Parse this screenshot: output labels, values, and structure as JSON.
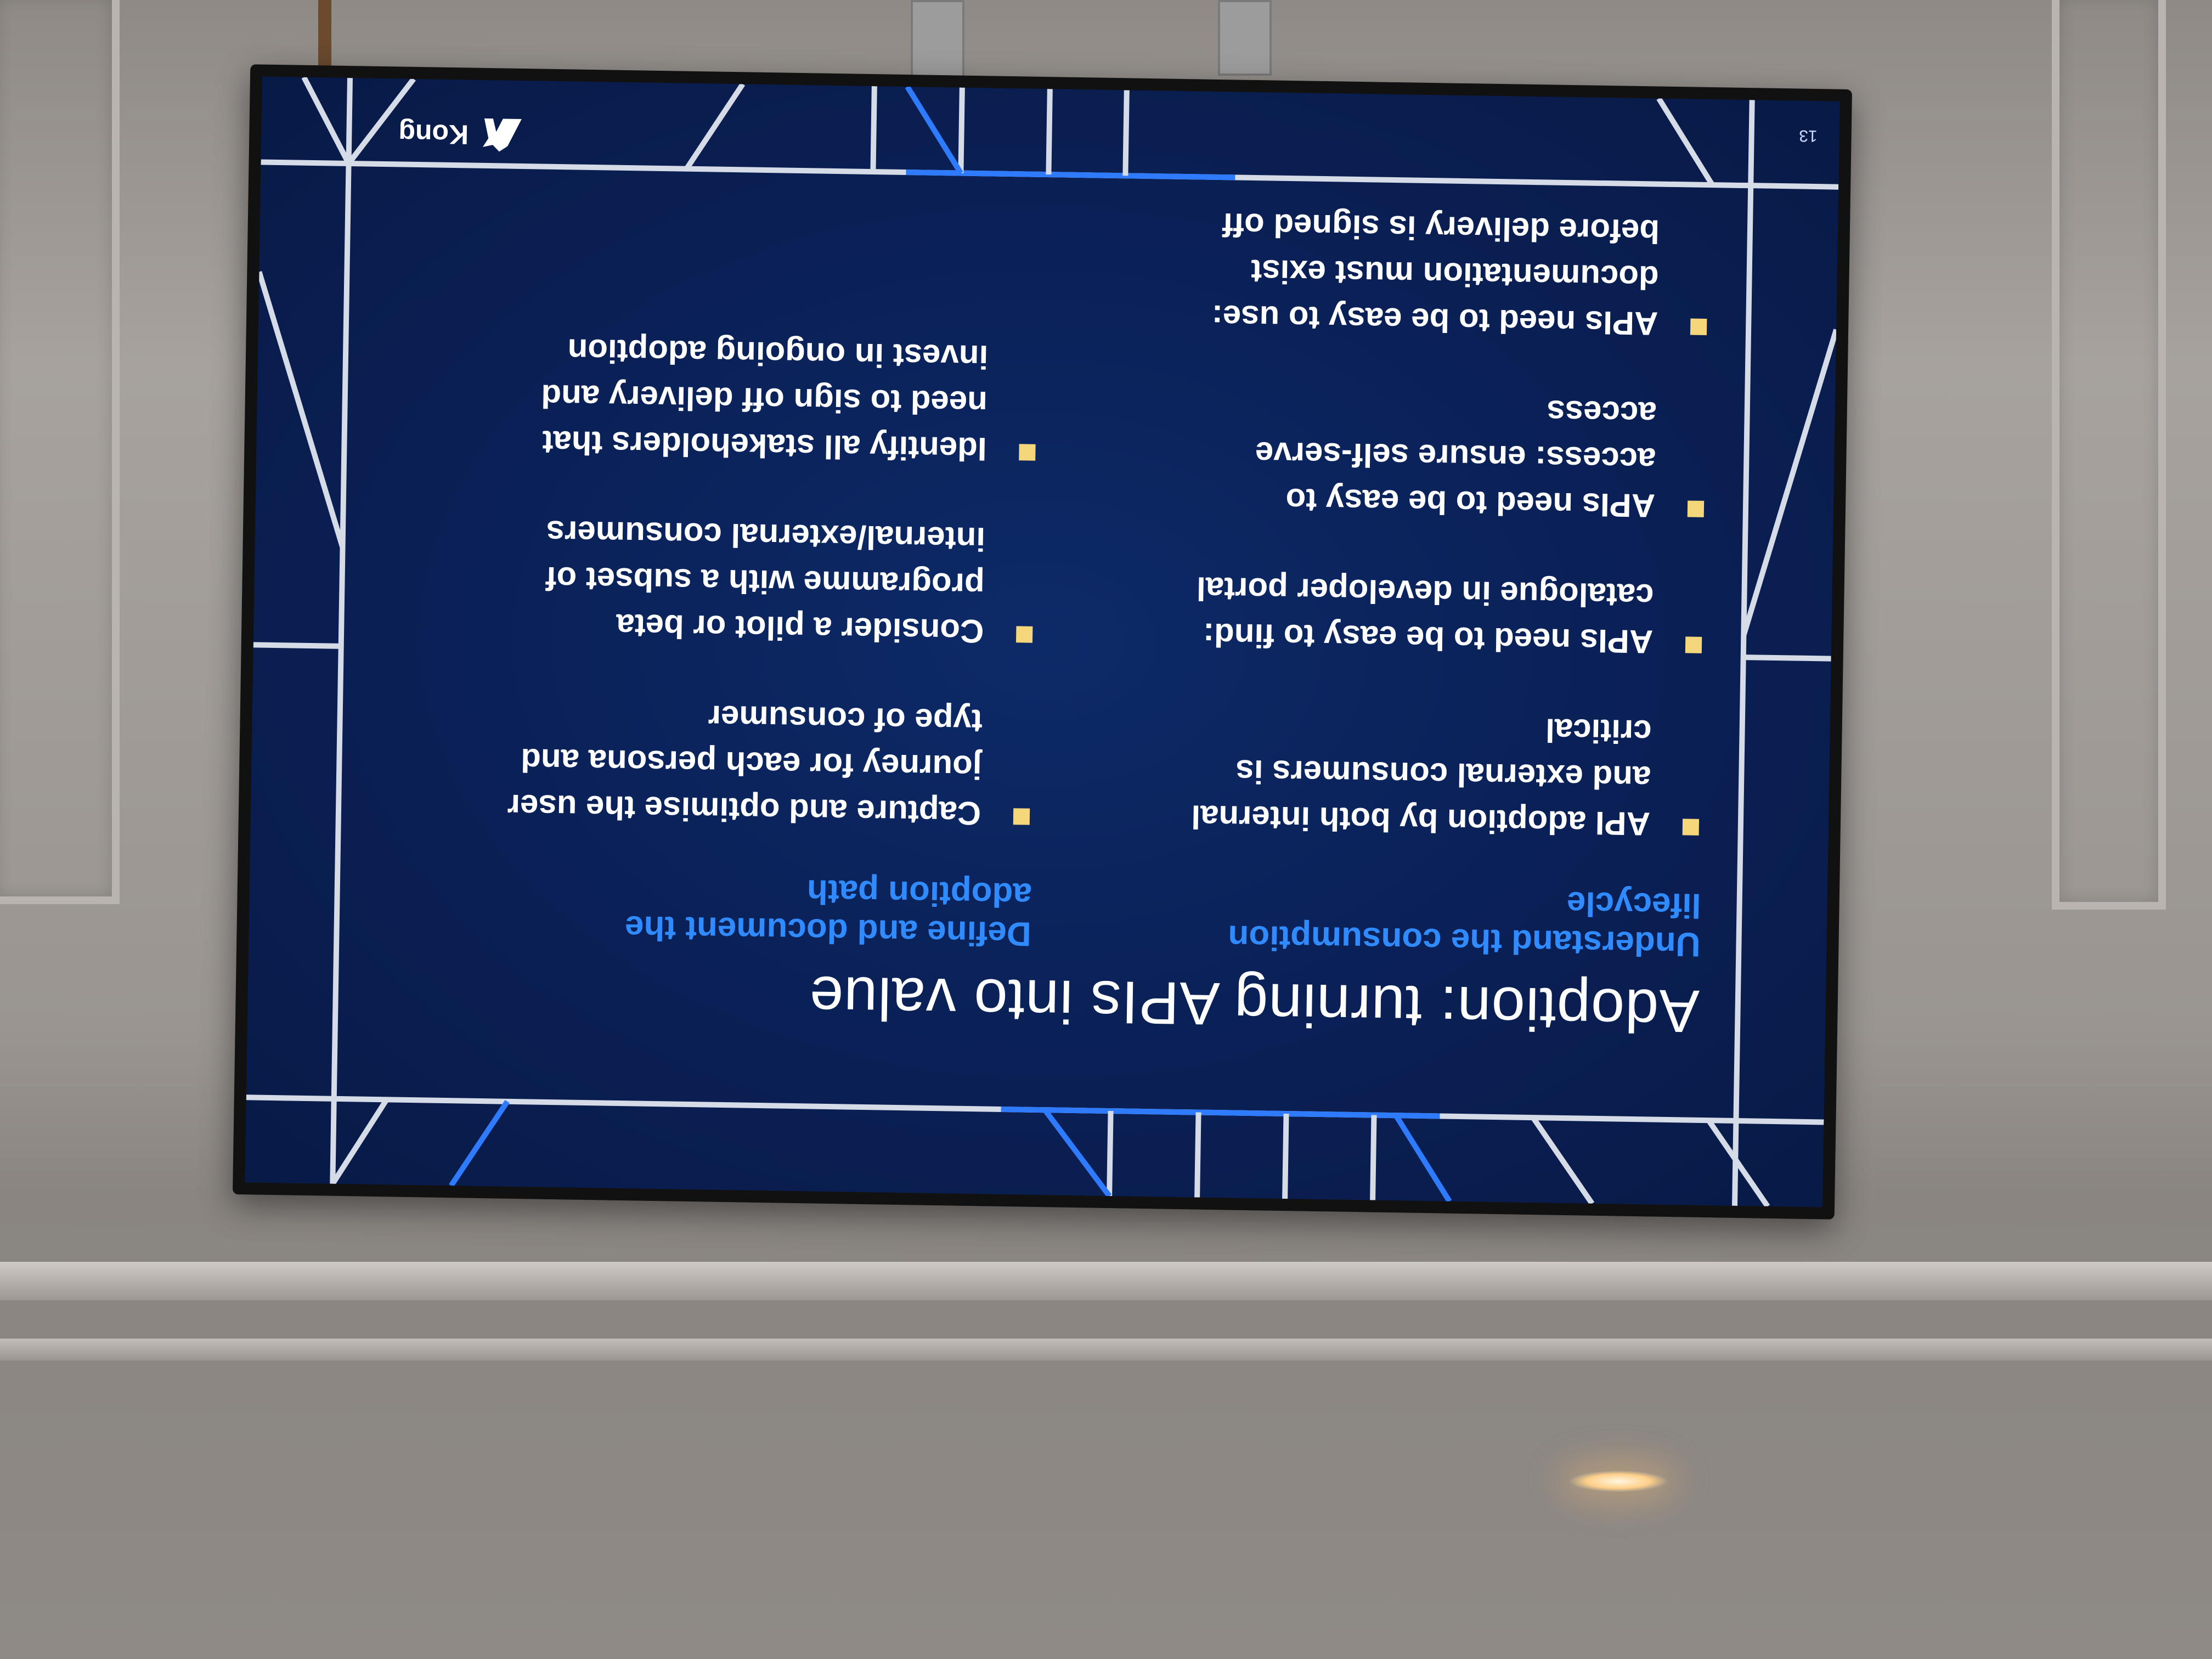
{
  "slide": {
    "title": "Adoption: turning APIs into value",
    "page_number": "13",
    "logo_text": "Kong",
    "columns": [
      {
        "heading": "Understand the consumption lifecycle",
        "bullets": [
          "API adoption by both internal and external consumers is critical",
          "APIs need to be easy to find: catalogue in developer portal",
          "APIs need to be easy to access: ensure self-serve access",
          "APIs need to be easy to use: documentation must exist before delivery is signed off"
        ]
      },
      {
        "heading": "Define and document the adoption path",
        "bullets": [
          "Capture and optimise the user journey for each persona and type of consumer",
          "Consider a pilot or beta programme with a subset of internal/external consumers",
          "Identify all stakeholders that need to sign off delivery and invest in ongoing adoption"
        ]
      }
    ]
  },
  "colors": {
    "slide_background": "#0a1f54",
    "heading_blue": "#2f8bff",
    "bullet_marker": "#f4d77a",
    "text": "#ffffff"
  },
  "icons": [
    "kong-logo-icon",
    "bullet-square-icon"
  ]
}
